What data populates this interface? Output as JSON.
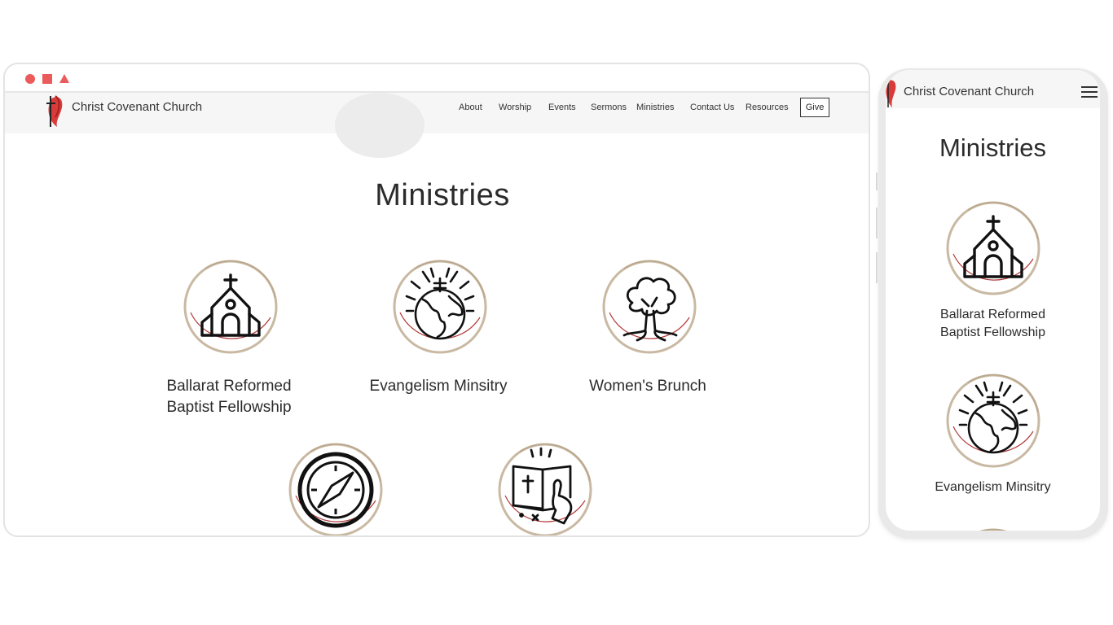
{
  "site": {
    "brand": "Christ Covenant Church",
    "nav": [
      "About",
      "Worship",
      "Events",
      "Sermons",
      "Ministries",
      "Contact Us",
      "Resources"
    ],
    "give_label": "Give",
    "accent": "#d93b3b"
  },
  "page": {
    "title": "Ministries",
    "ministries": [
      {
        "label": "Ballarat Reformed Baptist Fellowship",
        "line1": "Ballarat Reformed",
        "line2": "Baptist Fellowship",
        "icon": "church-icon"
      },
      {
        "label": "Evangelism Minsitry",
        "icon": "globe-cross-icon"
      },
      {
        "label": "Women's Brunch",
        "icon": "tree-icon"
      },
      {
        "label": "",
        "icon": "compass-icon"
      },
      {
        "label": "",
        "icon": "bible-hand-icon"
      }
    ]
  },
  "mobile": {
    "brand": "Christ Covenant Church",
    "title": "Ministries",
    "ministry1_line1": "Ballarat Reformed",
    "ministry1_line2": "Baptist Fellowship",
    "ministry2": "Evangelism Minsitry"
  }
}
